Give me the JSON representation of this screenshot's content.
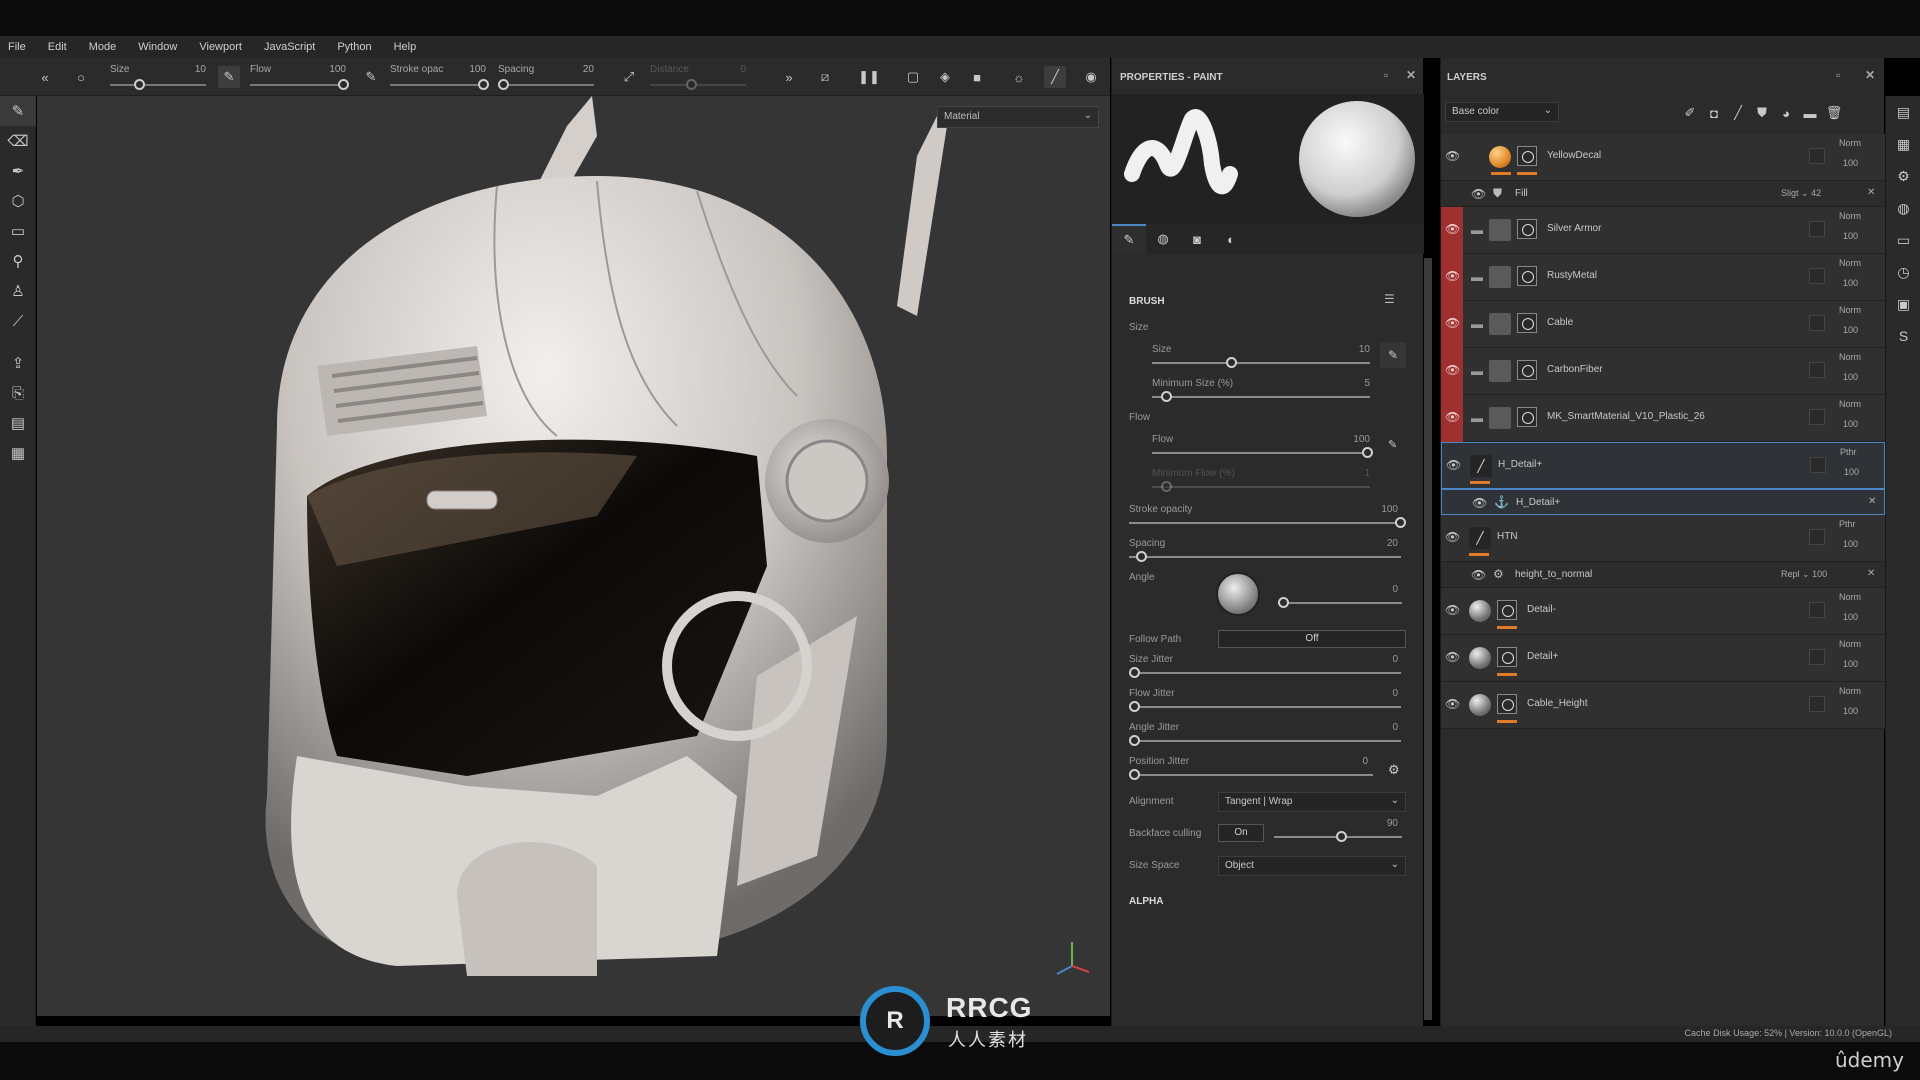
{
  "menu": [
    "File",
    "Edit",
    "Mode",
    "Window",
    "Viewport",
    "JavaScript",
    "Python",
    "Help"
  ],
  "toolbar": {
    "size_label": "Size",
    "size_value": "10",
    "flow_label": "Flow",
    "flow_value": "100",
    "stroke_label": "Stroke opac",
    "stroke_value": "100",
    "spacing_label": "Spacing",
    "spacing_value": "20",
    "distance_label": "Distance",
    "distance_value": "0"
  },
  "viewport": {
    "display_mode": "Material"
  },
  "properties": {
    "title": "PROPERTIES - PAINT",
    "brush_section": "BRUSH",
    "size_group": "Size",
    "size_label": "Size",
    "size_value": "10",
    "size_level": 0.36,
    "min_size_label": "Minimum Size (%)",
    "min_size_value": "5",
    "min_size_level": 0.05,
    "flow_group": "Flow",
    "flow_label": "Flow",
    "flow_value": "100",
    "flow_level": 1.0,
    "min_flow_label": "Minimum Flow (%)",
    "min_flow_value": "1",
    "min_flow_level": 0.05,
    "stroke_opacity_label": "Stroke opacity",
    "stroke_opacity_value": "100",
    "spacing_label": "Spacing",
    "spacing_value": "20",
    "angle_label": "Angle",
    "angle_value": "0",
    "follow_path_label": "Follow Path",
    "follow_path_value": "Off",
    "size_jitter_label": "Size Jitter",
    "size_jitter_value": "0",
    "flow_jitter_label": "Flow Jitter",
    "flow_jitter_value": "0",
    "angle_jitter_label": "Angle Jitter",
    "angle_jitter_value": "0",
    "position_jitter_label": "Position Jitter",
    "position_jitter_value": "0",
    "alignment_label": "Alignment",
    "alignment_value": "Tangent | Wrap",
    "backface_label": "Backface culling",
    "backface_toggle": "On",
    "backface_value": "90",
    "size_space_label": "Size Space",
    "size_space_value": "Object",
    "alpha_section": "ALPHA"
  },
  "layers": {
    "title": "LAYERS",
    "channel": "Base color",
    "items": [
      {
        "name": "YellowDecal",
        "blend": "Norm",
        "opacity": "100"
      },
      {
        "name": "Fill",
        "blend": "Sligt",
        "opacity": "42"
      },
      {
        "name": "Silver Armor",
        "blend": "Norm",
        "opacity": "100"
      },
      {
        "name": "RustyMetal",
        "blend": "Norm",
        "opacity": "100"
      },
      {
        "name": "Cable",
        "blend": "Norm",
        "opacity": "100"
      },
      {
        "name": "CarbonFiber",
        "blend": "Norm",
        "opacity": "100"
      },
      {
        "name": "MK_SmartMaterial_V10_Plastic_26",
        "blend": "Norm",
        "opacity": "100"
      },
      {
        "name": "H_Detail+",
        "blend": "Pthr",
        "opacity": "100"
      },
      {
        "name": "H_Detail+",
        "blend": "",
        "opacity": ""
      },
      {
        "name": "HTN",
        "blend": "Pthr",
        "opacity": "100"
      },
      {
        "name": "height_to_normal",
        "blend": "Repl",
        "opacity": "100"
      },
      {
        "name": "Detail-",
        "blend": "Norm",
        "opacity": "100"
      },
      {
        "name": "Detail+",
        "blend": "Norm",
        "opacity": "100"
      },
      {
        "name": "Cable_Height",
        "blend": "Norm",
        "opacity": "100"
      }
    ]
  },
  "status": "Cache Disk Usage:   52% | Version: 10.0.0 (OpenGL)",
  "watermark": {
    "brand": "RRCG",
    "sub": "人人素材"
  },
  "udemy": "ûdemy",
  "colors": {
    "accent": "#4a86c8",
    "layer_red": "#a03030",
    "orange": "#e07b2a"
  }
}
